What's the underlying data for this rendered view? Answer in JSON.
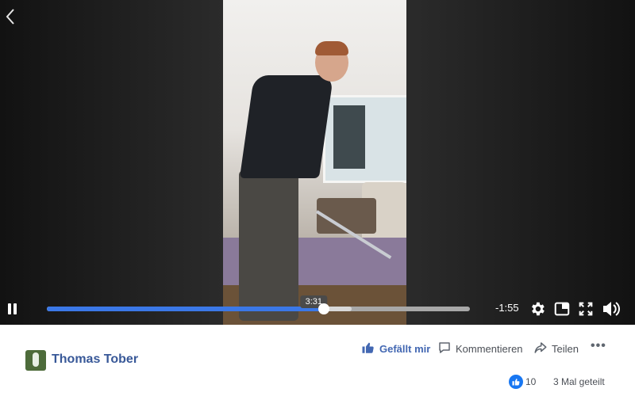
{
  "player": {
    "current_time": "3:31",
    "remaining_time": "-1:55",
    "progress": 0.655,
    "buffered": 0.72
  },
  "post": {
    "author": "Thomas Tober",
    "actions": {
      "like": "Gefällt mir",
      "comment": "Kommentieren",
      "share": "Teilen"
    },
    "like_count": "10",
    "share_count": "3 Mal geteilt"
  },
  "colors": {
    "accent": "#3b78e7",
    "brand_blue": "#4267b2",
    "name_blue": "#385898",
    "like_badge": "#1877f2"
  },
  "icons": {
    "back": "chevron-left-icon",
    "pause": "pause-icon",
    "settings": "gear-icon",
    "pip": "picture-in-picture-icon",
    "fullscreen": "fullscreen-icon",
    "volume": "volume-icon",
    "like": "thumbs-up-icon",
    "comment": "comment-icon",
    "share": "share-icon",
    "more": "more-icon"
  }
}
